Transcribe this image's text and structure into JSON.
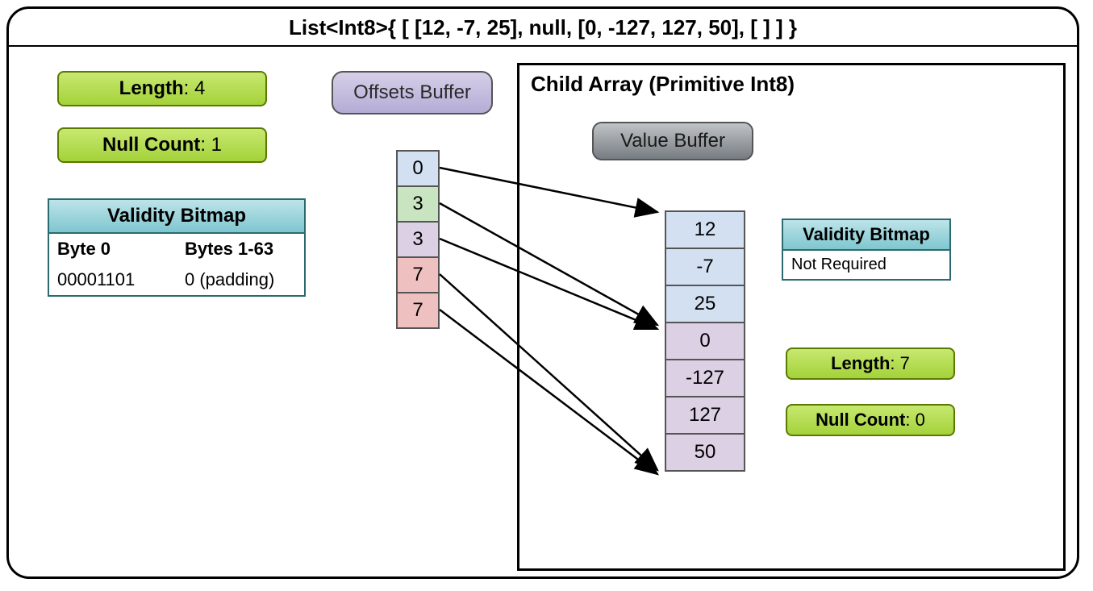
{
  "title": "List<Int8>{  [ [12, -7, 25], null, [0, -127, 127, 50], [ ] ] }",
  "parent": {
    "length_label": "Length",
    "length_value": ": 4",
    "null_label": "Null Count",
    "null_value": ": 1",
    "validity_title": "Validity Bitmap",
    "byte0_hdr": "Byte 0",
    "bytes1_hdr": "Bytes 1-63",
    "byte0_val": "00001101",
    "bytes1_val": "0 (padding)"
  },
  "offsets": {
    "title": "Offsets Buffer",
    "cells": [
      "0",
      "3",
      "3",
      "7",
      "7"
    ]
  },
  "child": {
    "title": "Child Array (Primitive Int8)",
    "value_buffer_title": "Value Buffer",
    "values": [
      "12",
      "-7",
      "25",
      "0",
      "-127",
      "127",
      "50"
    ],
    "validity_title": "Validity Bitmap",
    "validity_body": "Not Required",
    "length_label": "Length",
    "length_value": ": 7",
    "null_label": "Null Count",
    "null_value": ": 0"
  }
}
